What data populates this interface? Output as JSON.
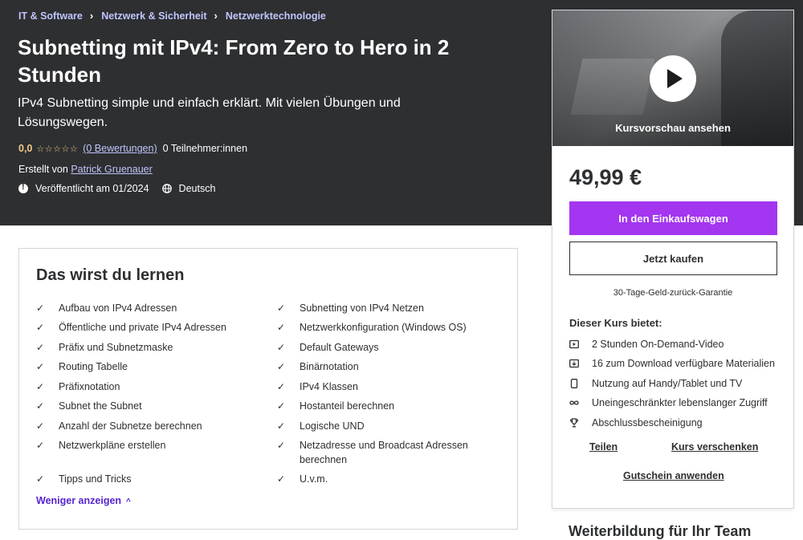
{
  "breadcrumb": [
    "IT & Software",
    "Netzwerk & Sicherheit",
    "Netzwerktechnologie"
  ],
  "course": {
    "title": "Subnetting mit IPv4: From Zero to Hero in 2 Stunden",
    "subtitle": "IPv4 Subnetting simple und einfach erklärt. Mit vielen Übungen und Lösungswegen.",
    "rating": "0,0",
    "rating_stars": "☆☆☆☆☆",
    "rating_count": "(0 Bewertungen)",
    "participants": "0 Teilnehmer:innen",
    "created_by_label": "Erstellt von",
    "instructor": "Patrick Gruenauer",
    "published": "Veröffentlicht am 01/2024",
    "language": "Deutsch"
  },
  "learn": {
    "heading": "Das wirst du lernen",
    "left": [
      "Aufbau von IPv4 Adressen",
      "Öffentliche und private IPv4 Adressen",
      "Präfix und Subnetzmaske",
      "Routing Tabelle",
      "Präfixnotation",
      "Subnet the Subnet",
      "Anzahl der Subnetze berechnen",
      "Netzwerkpläne erstellen",
      "Tipps und Tricks"
    ],
    "right": [
      "Subnetting von IPv4 Netzen",
      "Netzwerkkonfiguration (Windows OS)",
      "Default Gateways",
      "Binärnotation",
      "IPv4 Klassen",
      "Hostanteil berechnen",
      "Logische UND",
      "Netzadresse und Broadcast Adressen berechnen",
      "U.v.m."
    ],
    "check_glyph": "✓",
    "show_less": "Weniger anzeigen",
    "show_less_chevron": "^"
  },
  "sidebar": {
    "preview_label": "Kursvorschau ansehen",
    "price": "49,99 €",
    "cart_button": "In den Einkaufswagen",
    "buy_button": "Jetzt kaufen",
    "guarantee": "30-Tage-Geld-zurück-Garantie",
    "includes_title": "Dieser Kurs bietet:",
    "includes": [
      {
        "icon": "video-icon",
        "text": "2 Stunden On-Demand-Video"
      },
      {
        "icon": "download-icon",
        "text": "16 zum Download verfügbare Materialien"
      },
      {
        "icon": "mobile-icon",
        "text": "Nutzung auf Handy/Tablet und TV"
      },
      {
        "icon": "infinity-icon",
        "text": "Uneingeschränkter lebenslanger Zugriff"
      },
      {
        "icon": "trophy-icon",
        "text": "Abschlussbescheinigung"
      }
    ],
    "share": "Teilen",
    "gift": "Kurs verschenken",
    "coupon": "Gutschein anwenden",
    "next_section_title": "Weiterbildung für Ihr Team"
  },
  "colors": {
    "hero_bg": "#2d2f31",
    "accent_purple": "#a435f0",
    "link_lavender": "#c0c4fc",
    "star_gold": "#f3ca8c",
    "link_purple": "#5624d0"
  }
}
